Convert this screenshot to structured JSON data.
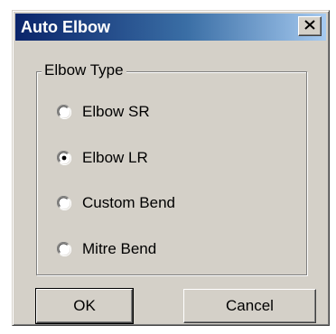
{
  "window": {
    "title": "Auto Elbow",
    "close_icon": "close-icon"
  },
  "group": {
    "label": "Elbow Type",
    "options": [
      {
        "label": "Elbow SR",
        "selected": false
      },
      {
        "label": "Elbow LR",
        "selected": true
      },
      {
        "label": "Custom Bend",
        "selected": false
      },
      {
        "label": "Mitre Bend",
        "selected": false
      }
    ]
  },
  "buttons": {
    "ok_label": "OK",
    "cancel_label": "Cancel"
  },
  "colors": {
    "title_bar_start": "#0a246a",
    "title_bar_end": "#a6caf0",
    "face": "#d4d0c8"
  }
}
